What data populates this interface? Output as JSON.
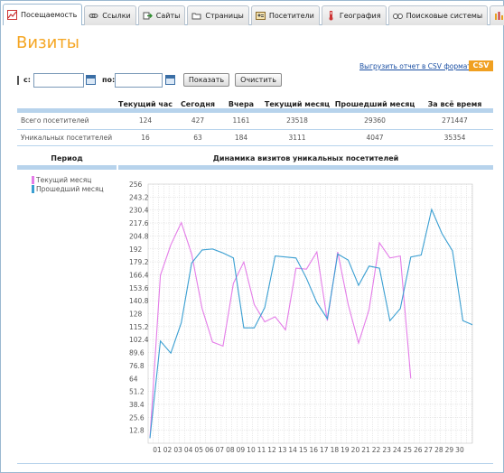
{
  "tabs": [
    {
      "label": "Посещаемость",
      "icon": "chart-icon",
      "active": true
    },
    {
      "label": "Ссылки",
      "icon": "links-icon",
      "active": false
    },
    {
      "label": "Сайты",
      "icon": "sites-arrow-icon",
      "active": false
    },
    {
      "label": "Страницы",
      "icon": "folder-icon",
      "active": false
    },
    {
      "label": "Посетители",
      "icon": "visitors-icon",
      "active": false
    },
    {
      "label": "География",
      "icon": "thermometer-icon",
      "active": false
    },
    {
      "label": "Поисковые системы",
      "icon": "binoculars-icon",
      "active": false
    },
    {
      "label": "",
      "icon": "bar-chart-icon",
      "active": false
    }
  ],
  "page": {
    "title": "Визиты"
  },
  "export": {
    "link_label": "Выгрузить отчет в CSV формате",
    "button_label": "CSV"
  },
  "filters": {
    "from_label": "с:",
    "from_value": "",
    "to_label": "по:",
    "to_value": "",
    "show_label": "Показать",
    "clear_label": "Очистить"
  },
  "stats": {
    "headers": [
      "",
      "Текущий час",
      "Сегодня",
      "Вчера",
      "Текущий месяц",
      "Прошедший месяц",
      "За всё время"
    ],
    "rows": [
      {
        "label": "Всего посетителей",
        "values": [
          "124",
          "427",
          "1161",
          "23518",
          "29360",
          "271447"
        ]
      },
      {
        "label": "Уникальных посетителей",
        "values": [
          "16",
          "63",
          "184",
          "3111",
          "4047",
          "35354"
        ]
      }
    ]
  },
  "chart_section": {
    "period_header": "Период"
  },
  "chart_data": {
    "type": "line",
    "title": "Динамика визитов уникальных посетителей",
    "xlabel": "",
    "ylabel": "",
    "categories": [
      "01",
      "02",
      "03",
      "04",
      "05",
      "06",
      "07",
      "08",
      "09",
      "10",
      "11",
      "12",
      "13",
      "14",
      "15",
      "16",
      "17",
      "18",
      "19",
      "20",
      "21",
      "22",
      "23",
      "24",
      "25",
      "26",
      "27",
      "28",
      "29",
      "30"
    ],
    "y_ticks": [
      "12.8",
      "25.6",
      "38.4",
      "51.2",
      "64",
      "76.8",
      "89.6",
      "102.4",
      "115.2",
      "128",
      "140.8",
      "153.6",
      "166.4",
      "179.2",
      "192",
      "204.8",
      "217.6",
      "230.4",
      "243.2",
      "256"
    ],
    "ylim": [
      0,
      256
    ],
    "grid": true,
    "legend_position": "top-left",
    "series": [
      {
        "name": "Текущий месяц",
        "color": "#e47de8",
        "values": [
          5,
          166,
          196,
          218,
          187,
          133,
          100,
          96,
          158,
          179,
          137,
          120,
          125,
          112,
          173,
          172,
          189,
          121,
          189,
          137,
          99,
          132,
          198,
          183,
          185,
          64
        ]
      },
      {
        "name": "Прошедший месяц",
        "color": "#3a9fd2",
        "values": [
          5,
          101,
          89,
          119,
          178,
          191,
          192,
          188,
          183,
          114,
          114,
          134,
          185,
          184,
          183,
          163,
          139,
          123,
          187,
          181,
          156,
          175,
          173,
          121,
          133,
          184,
          186,
          231,
          207,
          190,
          121,
          117
        ]
      }
    ]
  }
}
